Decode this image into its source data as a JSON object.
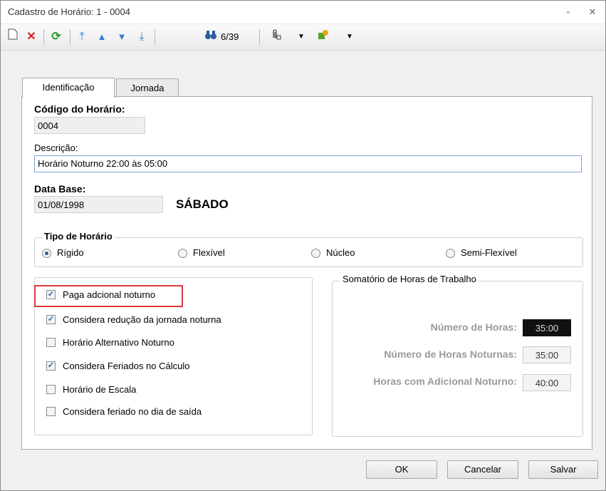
{
  "window": {
    "title": "Cadastro de Horário: 1 - 0004",
    "restore_glyph": "▫",
    "close_glyph": "✕"
  },
  "toolbar": {
    "record_counter": "6/39",
    "icons": [
      "new-doc-icon",
      "delete-icon",
      "refresh-icon",
      "first-icon",
      "prev-icon",
      "next-icon",
      "last-icon",
      "binoculars-icon",
      "attach-icon",
      "dropdown-icon",
      "plugin-icon",
      "dropdown-icon"
    ]
  },
  "tabs": [
    {
      "label": "Identificação",
      "active": true
    },
    {
      "label": "Jornada",
      "active": false
    }
  ],
  "form": {
    "codigo_label": "Código do Horário:",
    "codigo_value": "0004",
    "descricao_label": "Descrição:",
    "descricao_value": "Horário Noturno 22:00 às 05:00",
    "data_base_label": "Data Base:",
    "data_base_value": "01/08/1998",
    "weekday": "SÁBADO"
  },
  "tipo_horario": {
    "title": "Tipo de Horário",
    "options": [
      {
        "label": "Rígido",
        "selected": true
      },
      {
        "label": "Flexível",
        "selected": false
      },
      {
        "label": "Núcleo",
        "selected": false
      },
      {
        "label": "Semi-Flexível",
        "selected": false
      }
    ]
  },
  "options": [
    {
      "label": "Paga adcional noturno",
      "checked": true
    },
    {
      "label": "Considera redução da jornada noturna",
      "checked": true
    },
    {
      "label": "Horário Alternativo Noturno",
      "checked": false
    },
    {
      "label": "Considera Feriados no Cálculo",
      "checked": true
    },
    {
      "label": "Horário de Escala",
      "checked": false
    },
    {
      "label": "Considera feriado no dia de saída",
      "checked": false
    }
  ],
  "somatorio": {
    "title": "Somatório de Horas de Trabalho",
    "rows": [
      {
        "label": "Número de Horas:",
        "value": "35:00"
      },
      {
        "label": "Número de Horas Noturnas:",
        "value": "35:00"
      },
      {
        "label": "Horas com Adicional Noturno:",
        "value": "40:00"
      }
    ]
  },
  "buttons": {
    "ok": "OK",
    "cancel": "Cancelar",
    "save": "Salvar"
  },
  "colors": {
    "highlight": "#e03a3a",
    "accent": "#2a5d9c"
  }
}
